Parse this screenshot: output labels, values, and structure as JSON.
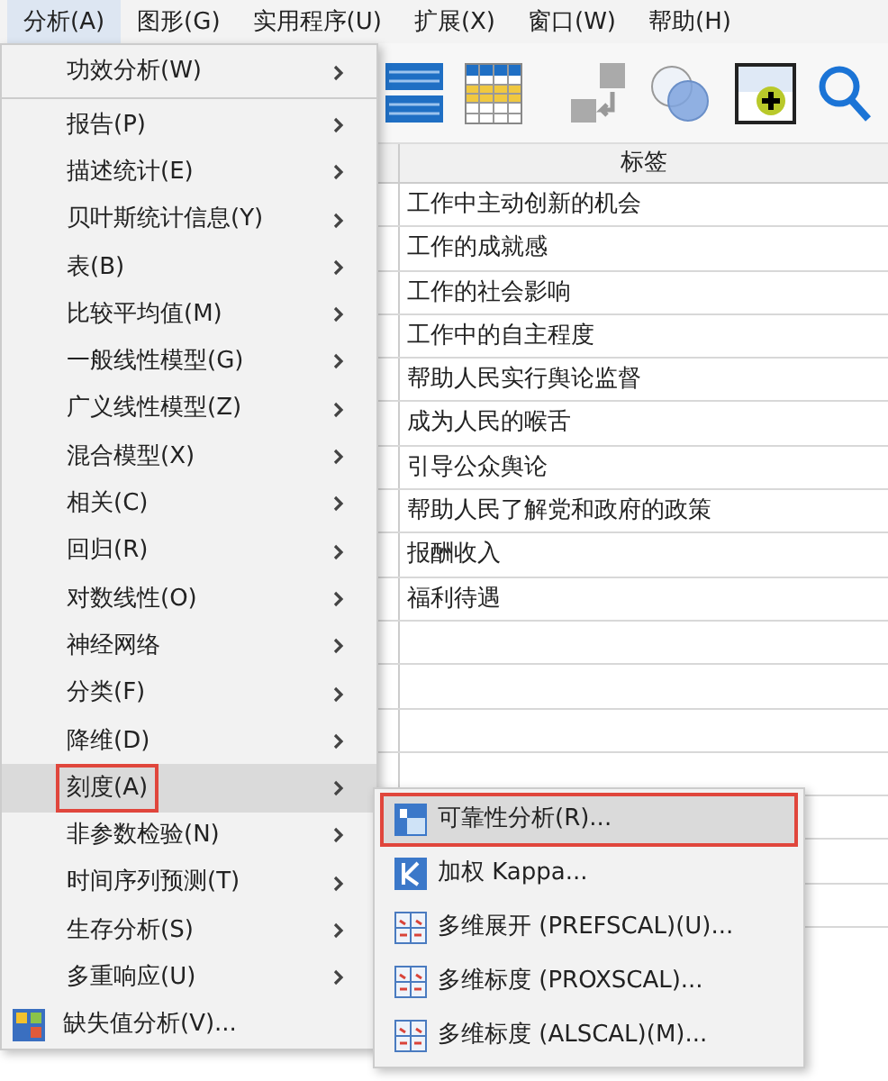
{
  "menubar": [
    {
      "label": "分析(A)",
      "selected": true
    },
    {
      "label": "图形(G)",
      "selected": false
    },
    {
      "label": "实用程序(U)",
      "selected": false
    },
    {
      "label": "扩展(X)",
      "selected": false
    },
    {
      "label": "窗口(W)",
      "selected": false
    },
    {
      "label": "帮助(H)",
      "selected": false
    }
  ],
  "table": {
    "columns": [
      "标签"
    ],
    "rows": [
      "工作中主动创新的机会",
      "工作的成就感",
      "工作的社会影响",
      "工作中的自主程度",
      "帮助人民实行舆论监督",
      "成为人民的喉舌",
      "引导公众舆论",
      "帮助人民了解党和政府的政策",
      "报酬收入",
      "福利待遇"
    ]
  },
  "menu": {
    "items": [
      {
        "label": "功效分析(W)",
        "kind": "submenu",
        "selected": false,
        "outlined": false,
        "separator_after": true
      },
      {
        "label": "报告(P)",
        "kind": "submenu",
        "selected": false,
        "outlined": false
      },
      {
        "label": "描述统计(E)",
        "kind": "submenu",
        "selected": false,
        "outlined": false
      },
      {
        "label": "贝叶斯统计信息(Y)",
        "kind": "submenu",
        "selected": false,
        "outlined": false
      },
      {
        "label": "表(B)",
        "kind": "submenu",
        "selected": false,
        "outlined": false
      },
      {
        "label": "比较平均值(M)",
        "kind": "submenu",
        "selected": false,
        "outlined": false
      },
      {
        "label": "一般线性模型(G)",
        "kind": "submenu",
        "selected": false,
        "outlined": false
      },
      {
        "label": "广义线性模型(Z)",
        "kind": "submenu",
        "selected": false,
        "outlined": false
      },
      {
        "label": "混合模型(X)",
        "kind": "submenu",
        "selected": false,
        "outlined": false
      },
      {
        "label": "相关(C)",
        "kind": "submenu",
        "selected": false,
        "outlined": false
      },
      {
        "label": "回归(R)",
        "kind": "submenu",
        "selected": false,
        "outlined": false
      },
      {
        "label": "对数线性(O)",
        "kind": "submenu",
        "selected": false,
        "outlined": false
      },
      {
        "label": "神经网络",
        "kind": "submenu",
        "selected": false,
        "outlined": false
      },
      {
        "label": "分类(F)",
        "kind": "submenu",
        "selected": false,
        "outlined": false
      },
      {
        "label": "降维(D)",
        "kind": "submenu",
        "selected": false,
        "outlined": false
      },
      {
        "label": "刻度(A)",
        "kind": "submenu",
        "selected": true,
        "outlined": true
      },
      {
        "label": "非参数检验(N)",
        "kind": "submenu",
        "selected": false,
        "outlined": false
      },
      {
        "label": "时间序列预测(T)",
        "kind": "submenu",
        "selected": false,
        "outlined": false
      },
      {
        "label": "生存分析(S)",
        "kind": "submenu",
        "selected": false,
        "outlined": false
      },
      {
        "label": "多重响应(U)",
        "kind": "submenu",
        "selected": false,
        "outlined": false
      },
      {
        "label": "缺失值分析(V)...",
        "kind": "command",
        "selected": false,
        "outlined": false
      }
    ]
  },
  "submenu": {
    "items": [
      {
        "label": "可靠性分析(R)...",
        "kind": "reliability",
        "selected": true,
        "outlined": true
      },
      {
        "label": "加权 Kappa...",
        "kind": "kappa",
        "selected": false,
        "outlined": false
      },
      {
        "label": "多维展开 (PREFSCAL)(U)...",
        "kind": "scaling",
        "selected": false,
        "outlined": false
      },
      {
        "label": "多维标度 (PROXSCAL)...",
        "kind": "scaling",
        "selected": false,
        "outlined": false
      },
      {
        "label": "多维标度 (ALSCAL)(M)...",
        "kind": "scaling",
        "selected": false,
        "outlined": false
      }
    ]
  }
}
